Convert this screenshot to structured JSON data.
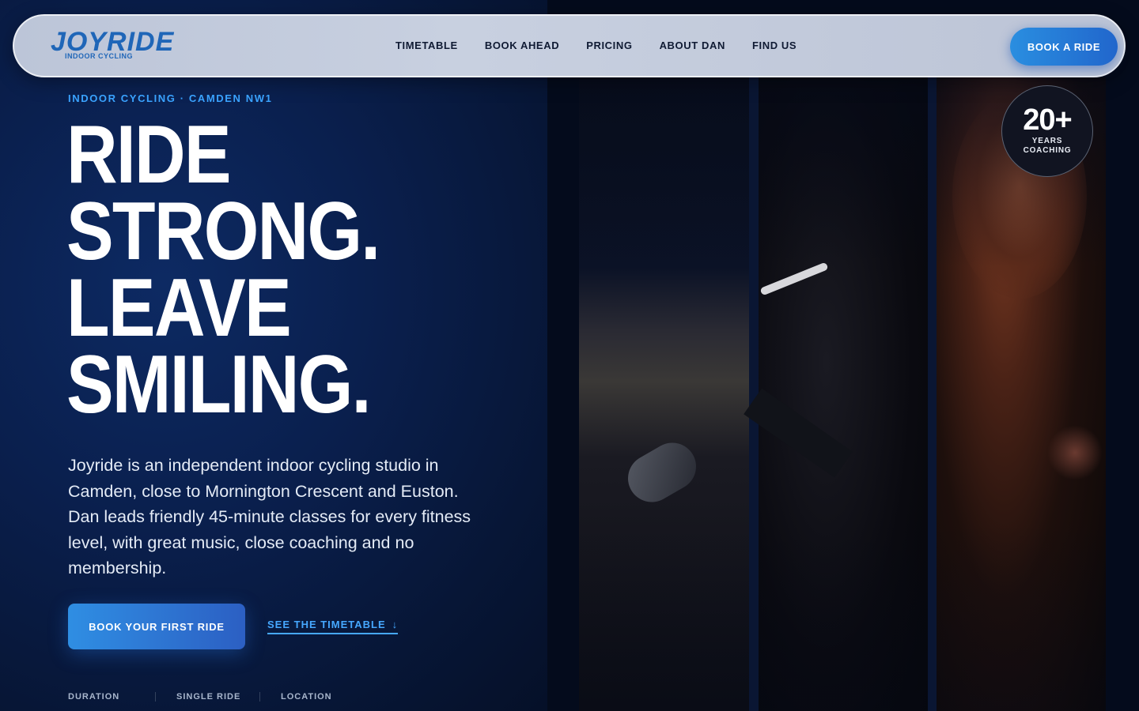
{
  "nav": {
    "logo_text": "JOYRIDE",
    "logo_subtext": "INDOOR CYCLING",
    "links": [
      "TIMETABLE",
      "BOOK AHEAD",
      "PRICING",
      "ABOUT DAN",
      "FIND US"
    ],
    "cta": "BOOK A RIDE"
  },
  "hero": {
    "eyebrow": "INDOOR CYCLING · CAMDEN NW1",
    "headline": [
      "RIDE",
      "STRONG.",
      "LEAVE",
      "SMILING."
    ],
    "intro": "Joyride is an independent indoor cycling studio in Camden, close to Mornington Crescent and Euston. Dan leads friendly 45-minute classes for every fitness level, with great music, close coaching and no membership.",
    "primary_button": "BOOK YOUR FIRST RIDE",
    "secondary_link": "SEE THE TIMETABLE",
    "secondary_arrow": "↓",
    "stats": [
      "DURATION",
      "SINGLE RIDE",
      "LOCATION"
    ]
  },
  "badge": {
    "number": "20+",
    "label_line1": "YEARS",
    "label_line2": "COACHING"
  },
  "colors": {
    "accent": "#3aa3ff",
    "cta_blue": "#2a8ee0",
    "background": "#051028"
  }
}
